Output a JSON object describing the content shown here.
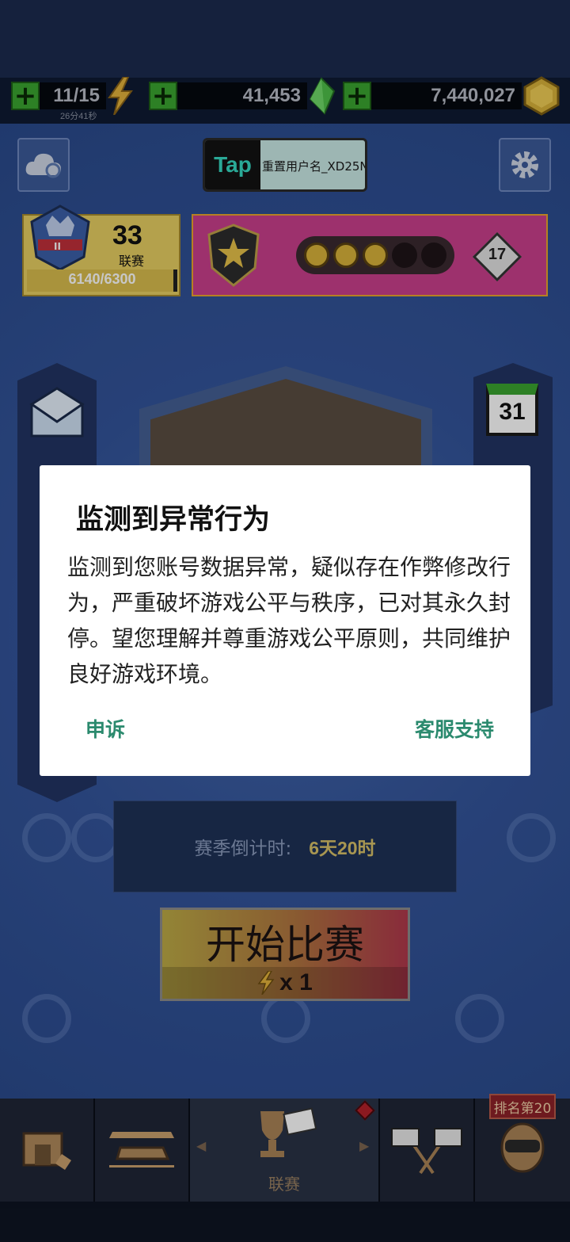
{
  "resources": {
    "energy": {
      "value": "11/15",
      "timer": "26分41秒"
    },
    "gems": {
      "value": "41,453"
    },
    "coins": {
      "value": "7,440,027"
    }
  },
  "header": {
    "tap_logo": "Tap",
    "username": "重置用户名_XD25N"
  },
  "league": {
    "number": "33",
    "label": "联赛",
    "rank_roman": "II",
    "progress_text": "6140/6300",
    "progress": 0.975
  },
  "stars": {
    "filled": 3,
    "total": 5,
    "level": "17"
  },
  "side_left": {
    "date": ""
  },
  "side_right": {
    "calendar_day": "31"
  },
  "season": {
    "countdown_label": "赛季倒计时:",
    "countdown_value": "6天20时"
  },
  "start": {
    "label": "开始比赛",
    "cost": "x 1"
  },
  "nav": {
    "league_label": "联赛",
    "rank_badge": "排名第20"
  },
  "dialog": {
    "title": "监测到异常行为",
    "message": "监测到您账号数据异常，疑似存在作弊修改行为，严重破坏游戏公平与秩序，已对其永久封停。望您理解并尊重游戏公平原则，共同维护良好游戏环境。",
    "appeal_label": "申诉",
    "support_label": "客服支持"
  },
  "colors": {
    "accent_teal": "#2b8a6e",
    "plus_green": "#3aa530",
    "league_gold": "#e7cf62",
    "star_pink": "#c93f8c"
  },
  "icons": [
    "cloud-sync-icon",
    "gear-icon",
    "league-crest-icon",
    "star-shield-icon",
    "mail-icon",
    "calendar-icon",
    "lightning-icon",
    "gem-icon",
    "coin-icon",
    "garage-icon",
    "car-icon",
    "trophy-icon",
    "race-flags-icon",
    "helmet-icon"
  ]
}
